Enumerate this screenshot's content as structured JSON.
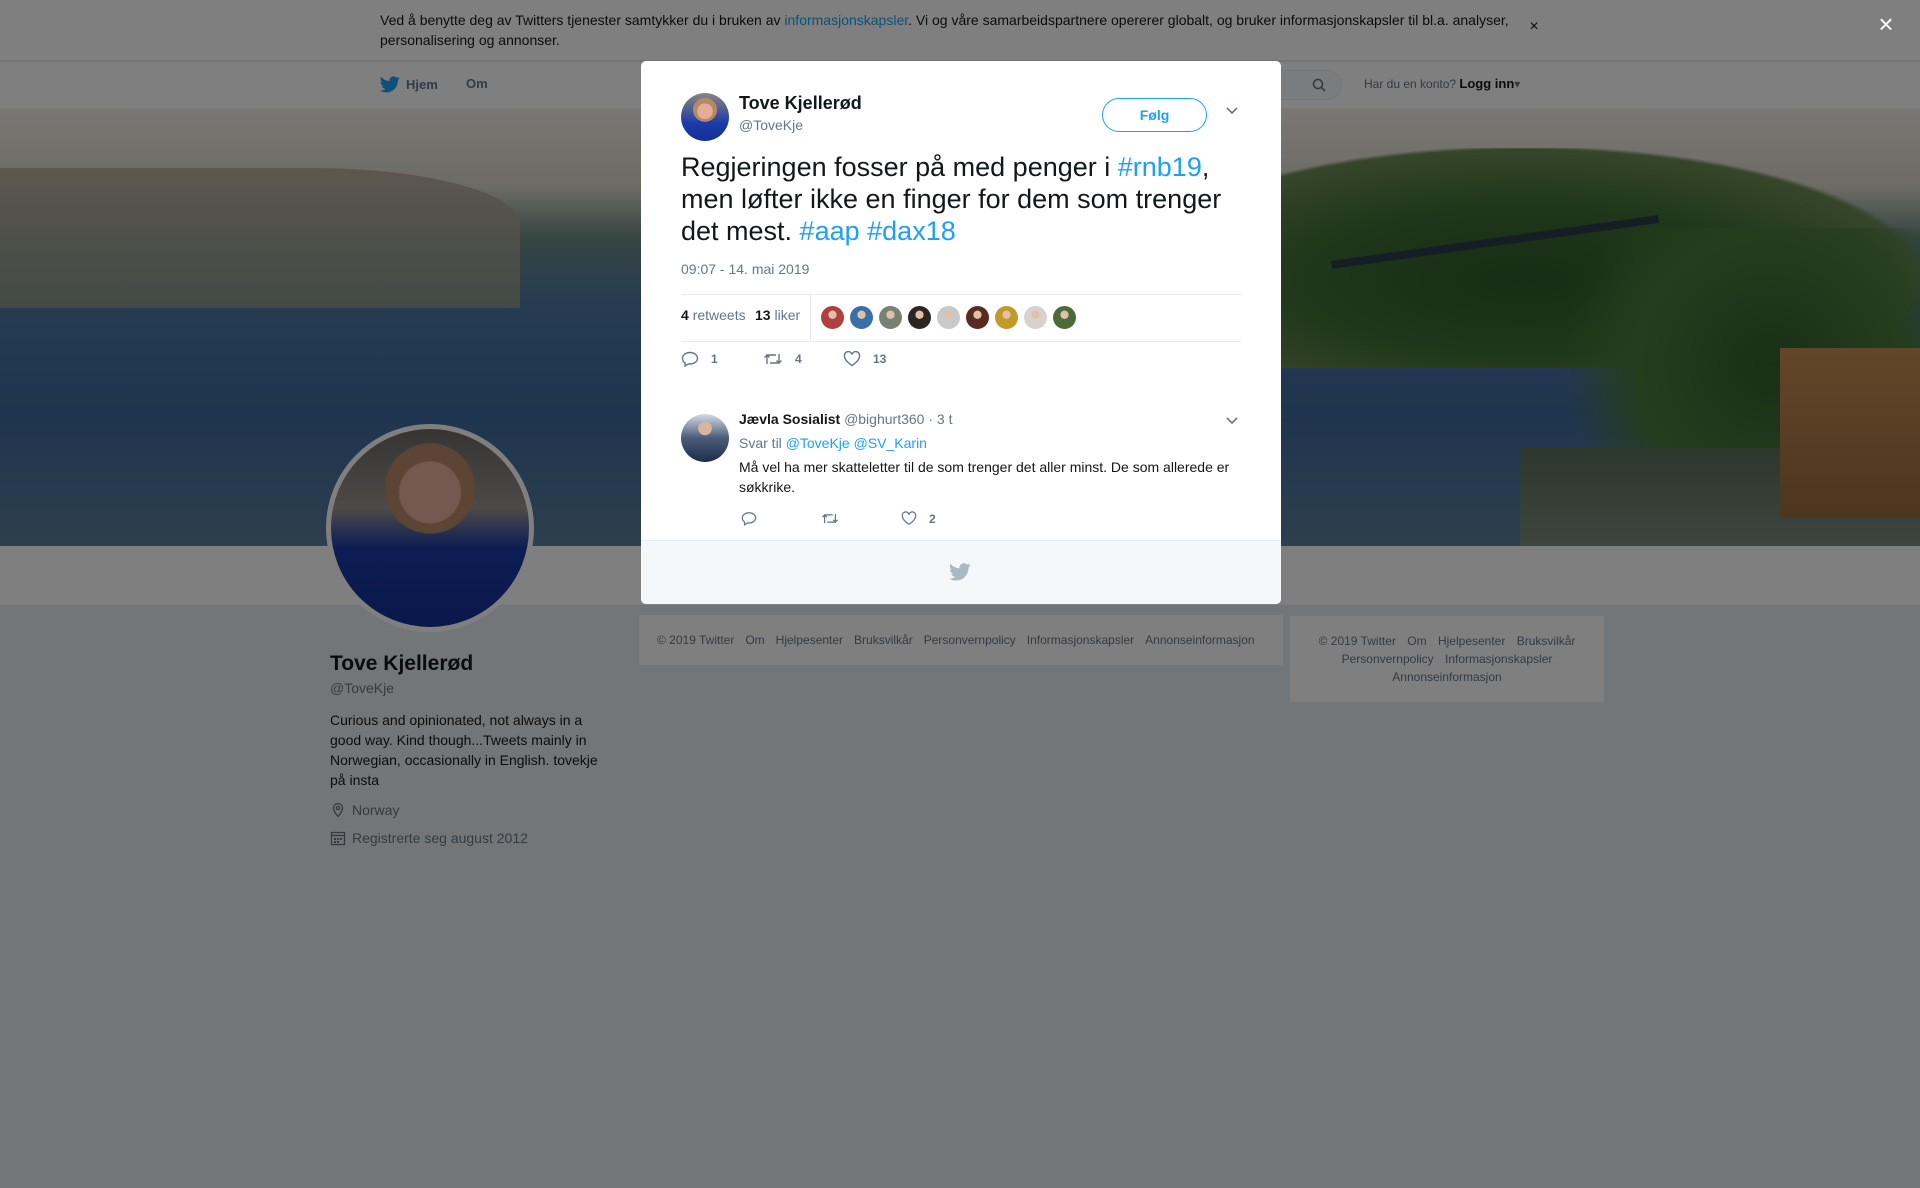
{
  "cookie_bar": {
    "text_before": "Ved å benytte deg av Twitters tjenester samtykker du i bruken av ",
    "link": "informasjonskapsler",
    "text_after": ". Vi og våre samarbeidspartnere opererer globalt, og bruker informasjonskapsler til bl.a. analyser, personalisering og annonser.",
    "close_glyph": "×"
  },
  "nav": {
    "home": "Hjem",
    "about": "Om",
    "account_prompt": "Har du en konto?",
    "login": "Logg inn",
    "login_caret": "▾"
  },
  "profile": {
    "name": "Tove Kjellerød",
    "handle": "@ToveKje",
    "bio": "Curious and opinionated, not always in a good way. Kind though...Tweets mainly in Norwegian, occasionally in English. tovekje på insta",
    "location": "Norway",
    "joined": "Registrerte seg august 2012"
  },
  "footer_center": [
    "© 2019 Twitter",
    "Om",
    "Hjelpesenter",
    "Bruksvilkår",
    "Personvernpolicy",
    "Informasjonskapsler",
    "Annonseinformasjon"
  ],
  "footer_right": {
    "line1": [
      "© 2019 Twitter",
      "Om",
      "Hjelpesenter",
      "Bruksvilkår"
    ],
    "line2": [
      "Personvernpolicy",
      "Informasjonskapsler"
    ],
    "line3": [
      "Annonseinformasjon"
    ]
  },
  "overlay_close": "×",
  "tweet": {
    "author_name": "Tove Kjellerød",
    "author_handle": "@ToveKje",
    "follow_label": "Følg",
    "text_1": "Regjeringen fosser på med penger i ",
    "hashtag_1": "#rnb19",
    "text_2": ", men løfter ikke en finger for dem som trenger det mest. ",
    "hashtag_2": "#aap",
    "text_3": " ",
    "hashtag_3": "#dax18",
    "timestamp": "09:07 - 14. mai 2019",
    "retweets_count": "4",
    "retweets_label": "retweets",
    "likes_count": "13",
    "likes_label": "liker",
    "likers": [
      "#b04040",
      "#3a6ea8",
      "#7a8072",
      "#2c2623",
      "#c9c9c9",
      "#5a2a20",
      "#c29a2a",
      "#d9d0d0",
      "#4d6a3a"
    ],
    "action_reply_count": "1",
    "action_retweet_count": "4",
    "action_like_count": "13"
  },
  "reply": {
    "name": "Jævla Sosialist",
    "handle": "@bighurt360",
    "time": "· 3 t",
    "reply_to_label": "Svar til",
    "reply_to_1": "@ToveKje",
    "reply_to_2": "@SV_Karin",
    "text": "Må vel ha mer skatteletter til de som trenger det aller minst. De som allerede er søkkrike.",
    "like_count": "2"
  },
  "colors": {
    "accent": "#1da1f2",
    "text": "#14171a",
    "muted": "#657786",
    "background": "#e6ecf0"
  }
}
